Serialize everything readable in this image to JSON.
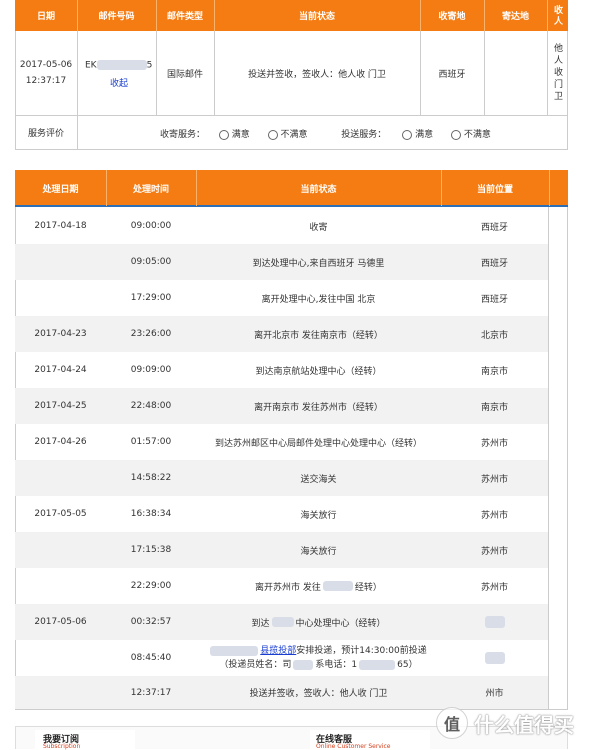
{
  "mail_table": {
    "headers": [
      "日期",
      "邮件号码",
      "邮件类型",
      "当前状态",
      "收寄地",
      "寄达地",
      "收人"
    ],
    "row": {
      "date": "2017-05-06 12:37:17",
      "tracking_prefix": "EK",
      "tracking_suffix": "5",
      "collapse_link": "收起",
      "type": "国际邮件",
      "status": "投送并签收，签收人：他人收 门卫",
      "origin": "西班牙",
      "destination": "",
      "receiver": "他人收门卫"
    },
    "rating": {
      "label": "服务评价",
      "pickup_label": "收寄服务：",
      "delivery_label": "投送服务：",
      "satisfied": "满意",
      "unsatisfied": "不满意"
    }
  },
  "track_table": {
    "headers": [
      "处理日期",
      "处理时间",
      "当前状态",
      "当前位置"
    ],
    "rows": [
      {
        "date": "2017-04-18",
        "time": "09:00:00",
        "status": "收寄",
        "location": "西班牙"
      },
      {
        "date": "",
        "time": "09:05:00",
        "status": "到达处理中心,来自西班牙 马德里",
        "location": "西班牙"
      },
      {
        "date": "",
        "time": "17:29:00",
        "status": "离开处理中心,发往中国 北京",
        "location": "西班牙"
      },
      {
        "date": "2017-04-23",
        "time": "23:26:00",
        "status": "离开北京市 发往南京市（经转）",
        "location": "北京市"
      },
      {
        "date": "2017-04-24",
        "time": "09:09:00",
        "status": "到达南京航站处理中心（经转）",
        "location": "南京市"
      },
      {
        "date": "2017-04-25",
        "time": "22:48:00",
        "status": "离开南京市 发往苏州市（经转）",
        "location": "南京市"
      },
      {
        "date": "2017-04-26",
        "time": "01:57:00",
        "status": "到达苏州邮区中心局邮件处理中心处理中心（经转）",
        "location": "苏州市"
      },
      {
        "date": "",
        "time": "14:58:22",
        "status": "送交海关",
        "location": "苏州市"
      },
      {
        "date": "2017-05-05",
        "time": "16:38:34",
        "status": "海关放行",
        "location": "苏州市"
      },
      {
        "date": "",
        "time": "17:15:38",
        "status": "海关放行",
        "location": "苏州市"
      },
      {
        "date": "",
        "time": "22:29:00",
        "status": "离开苏州市 发往",
        "status_tail": "经转）",
        "location": "苏州市"
      },
      {
        "date": "2017-05-06",
        "time": "00:32:57",
        "status": "到达",
        "status_tail": "中心处理中心（经转）",
        "location": ""
      },
      {
        "date": "",
        "time": "08:45:40",
        "status_link": "县揽投部",
        "status": "安排投递，预计14:30:00前投递",
        "status_line2a": "（投递员姓名：司",
        "status_line2b": "系电话：1",
        "status_line2c": "65）",
        "location": ""
      },
      {
        "date": "",
        "time": "12:37:17",
        "status": "投送并签收，签收人：他人收 门卫",
        "location": "州市"
      }
    ]
  },
  "footer": {
    "subscribe_title": "我要订阅",
    "subscribe_sub": "Subscription",
    "service_title": "在线客服",
    "service_sub": "Online Customer Service"
  },
  "watermark": {
    "brand": "什么值得买",
    "badge": "值"
  },
  "colors": {
    "header": "#f57c12",
    "stripe": "#f2f2f2",
    "link": "#1a3fd0"
  }
}
